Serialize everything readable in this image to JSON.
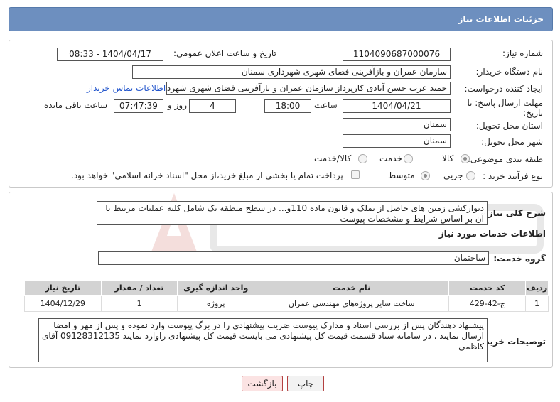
{
  "page": {
    "title": "جزئیات اطلاعات نیاز"
  },
  "form": {
    "need_number_label": "شماره نیاز:",
    "need_number": "1104090687000076",
    "announce_label": "تاریخ و ساعت اعلان عمومی:",
    "announce_value": "1404/04/17 - 08:33",
    "buyer_org_label": "نام دستگاه خریدار:",
    "buyer_org": "سازمان عمران و بازآفرینی فضای شهری شهرداری سمنان",
    "creator_label": "ایجاد کننده درخواست:",
    "creator": "حمید عرب حسن آبادی کارپرداز سازمان عمران و بازآفرینی فضای شهری شهردار",
    "contact_link": "اطلاعات تماس خریدار",
    "deadline_label_1": "مهلت ارسال پاسخ: تا",
    "deadline_label_2": "تاریخ:",
    "deadline_date": "1404/04/21",
    "time_label": "ساعت",
    "deadline_time": "18:00",
    "days_value": "4",
    "days_label": "روز و",
    "remaining_time": "07:47:39",
    "remaining_label": "ساعت باقی مانده",
    "province_label": "استان محل تحویل:",
    "province": "سمنان",
    "city_label": "شهر محل تحویل:",
    "city": "سمنان",
    "category_label": "طبقه بندی موضوعی:",
    "category_options": [
      "کالا",
      "خدمت",
      "کالا/خدمت"
    ],
    "process_label": "نوع فرآیند خرید :",
    "process_options": [
      "جزیی",
      "متوسط"
    ],
    "payment_note": "پرداخت تمام یا بخشی از مبلغ خرید،از محل \"اسناد خزانه اسلامی\" خواهد بود."
  },
  "details": {
    "summary_label": "شرح کلی نیاز:",
    "summary": "دیوارکشی زمین های حاصل از تملک و قانون ماده 110و... در سطح منطقه یک شامل کلیه عملیات مرتبط با آن بر اساس شرایط و  مشخصات پیوست",
    "services_title": "اطلاعات خدمات مورد نیاز",
    "service_group_label": "گروه خدمت:",
    "service_group": "ساختمان",
    "table": {
      "headers": [
        "ردیف",
        "کد خدمت",
        "نام خدمت",
        "واحد اندازه گیری",
        "تعداد / مقدار",
        "تاریخ نیاز"
      ],
      "rows": [
        [
          "1",
          "ج-42-429",
          "ساخت سایر پروژه‌های مهندسی عمران",
          "پروژه",
          "1",
          "1404/12/29"
        ]
      ]
    },
    "buyer_notes_label": "توضیحات خریدار:",
    "buyer_notes": "پیشنهاد دهندگان پس از بررسی اسناد و مدارک پیوست ضریب پیشنهادی را در برگ پیوست وارد نموده و پس از مهر و امضا ارسال نمایند ، در سامانه ستاد قسمت قیمت کل پیشنهادی می بایست قیمت کل پیشنهادی راوارد نمایند 09128312135 آقای کاظمی"
  },
  "buttons": {
    "print": "چاپ",
    "back": "بازگشت"
  },
  "colors": {
    "header": "#6d8fbf",
    "link": "#2255cc",
    "button_border": "#b34040"
  }
}
